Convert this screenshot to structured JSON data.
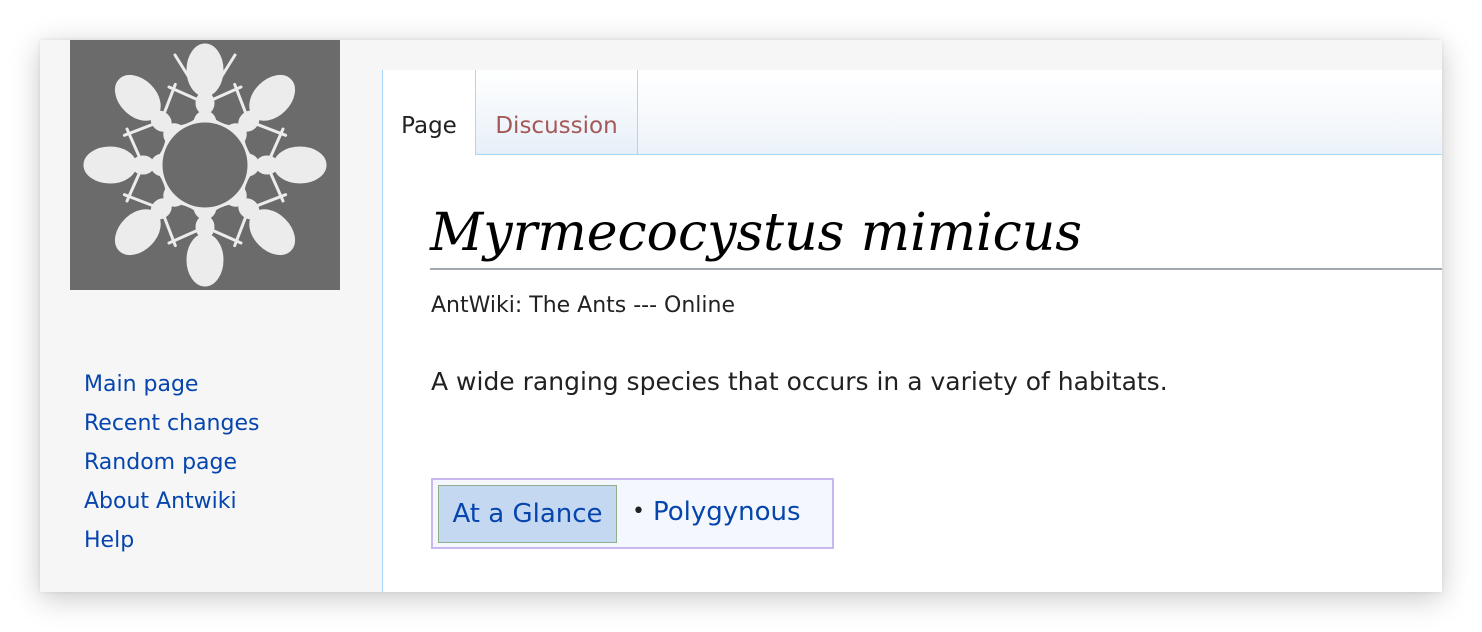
{
  "logo": {
    "icon": "ant-wheel-logo-icon",
    "bg_color": "#6b6b6b"
  },
  "sidebar": {
    "items": [
      {
        "label": "Main page"
      },
      {
        "label": "Recent changes"
      },
      {
        "label": "Random page"
      },
      {
        "label": "About Antwiki"
      },
      {
        "label": "Help"
      }
    ]
  },
  "tabs": [
    {
      "label": "Page",
      "active": true
    },
    {
      "label": "Discussion",
      "active": false
    }
  ],
  "article": {
    "title": "Myrmecocystus mimicus",
    "tagline": "AntWiki: The Ants --- Online",
    "summary": "A wide ranging species that occurs in a variety of habitats."
  },
  "glance": {
    "label": "At a Glance",
    "bullet": "•",
    "items": [
      {
        "label": "Polygynous"
      }
    ]
  },
  "colors": {
    "link": "#0645ad",
    "tab_discussion": "#a55858",
    "border": "#a7d7f9",
    "glance_border": "#c9b7ef"
  }
}
